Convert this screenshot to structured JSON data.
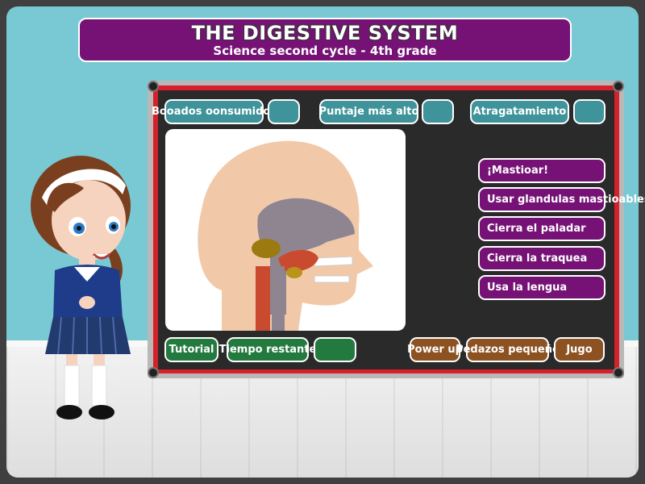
{
  "header": {
    "title": "THE DIGESTIVE SYSTEM",
    "subtitle": "Science second cycle - 4th grade"
  },
  "board": {
    "top_stats": [
      {
        "label": "Booados oonsumidos",
        "value": ""
      },
      {
        "label": "Puntaje más alto",
        "value": ""
      },
      {
        "label": "Atragatamiento",
        "value": ""
      }
    ],
    "actions": [
      "¡Mastioar!",
      "Usar glandulas mastioables",
      "Cierra el paladar",
      "Cierra la traquea",
      "Usa la lengua"
    ],
    "bottom": {
      "tutorial": "Tutorial",
      "time_label": "Tiempo restante",
      "time_value": "",
      "power_up": "Power up",
      "small_pieces": "Pedazos pequeño",
      "play": "Jugo"
    }
  },
  "colors": {
    "header_purple": "#761276",
    "teal": "#3f939a",
    "green": "#237a3e",
    "brown": "#8d5221",
    "board_red": "#d6202a",
    "wall": "#78c9d3"
  },
  "illustration": "head-cross-section",
  "character": "schoolgirl"
}
